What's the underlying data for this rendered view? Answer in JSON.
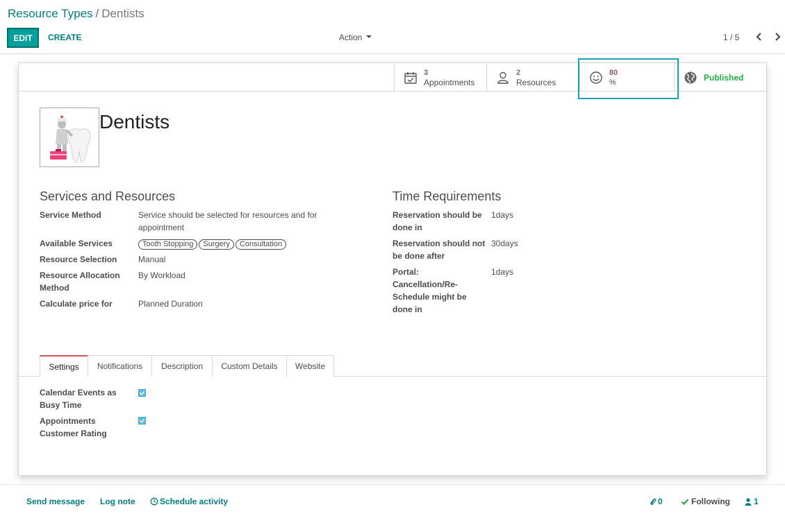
{
  "breadcrumb": {
    "parent": "Resource Types",
    "separator": "/",
    "current": "Dentists"
  },
  "toolbar": {
    "edit_label": "EDIT",
    "create_label": "CREATE",
    "action_label": "Action"
  },
  "pager": {
    "value": "1 / 5"
  },
  "stat_buttons": {
    "appointments": {
      "value": "3",
      "label": "Appointments"
    },
    "resources": {
      "value": "2",
      "label": "Resources"
    },
    "rating": {
      "value": "80",
      "label": "%"
    },
    "published": {
      "label": "Published"
    }
  },
  "record": {
    "name": "Dentists"
  },
  "services": {
    "title": "Services and Resources",
    "service_method": {
      "label": "Service Method",
      "value": "Service should be selected for resources and for appointment"
    },
    "available_services": {
      "label": "Available Services",
      "tags": [
        "Tooth Stopping",
        "Surgery",
        "Consultation"
      ]
    },
    "resource_selection": {
      "label": "Resource Selection",
      "value": "Manual"
    },
    "allocation_method": {
      "label": "Resource Allocation Method",
      "value": "By Workload"
    },
    "price_for": {
      "label": "Calculate price for",
      "value": "Planned Duration"
    }
  },
  "time": {
    "title": "Time Requirements",
    "done_in": {
      "label": "Reservation should be done in",
      "value": "1days"
    },
    "not_after": {
      "label": "Reservation should not be done after",
      "value": "30days"
    },
    "portal": {
      "label": "Portal: Cancellation/Re-Schedule might be done in",
      "value": "1days"
    }
  },
  "tabs": [
    "Settings",
    "Notifications",
    "Description",
    "Custom Details",
    "Website"
  ],
  "settings": {
    "calendar_busy": {
      "label": "Calendar Events as Busy Time",
      "checked": true
    },
    "customer_rating": {
      "label": "Appointments Customer Rating",
      "checked": true
    }
  },
  "chatter": {
    "send_message": "Send message",
    "log_note": "Log note",
    "schedule_activity": "Schedule activity",
    "attachments": "0",
    "following": "Following",
    "followers": "1"
  },
  "colors": {
    "primary": "#00a09d",
    "link": "#017e84",
    "stat_value": "#875a7b",
    "published": "#28a745",
    "focus": "#17a2b8"
  }
}
